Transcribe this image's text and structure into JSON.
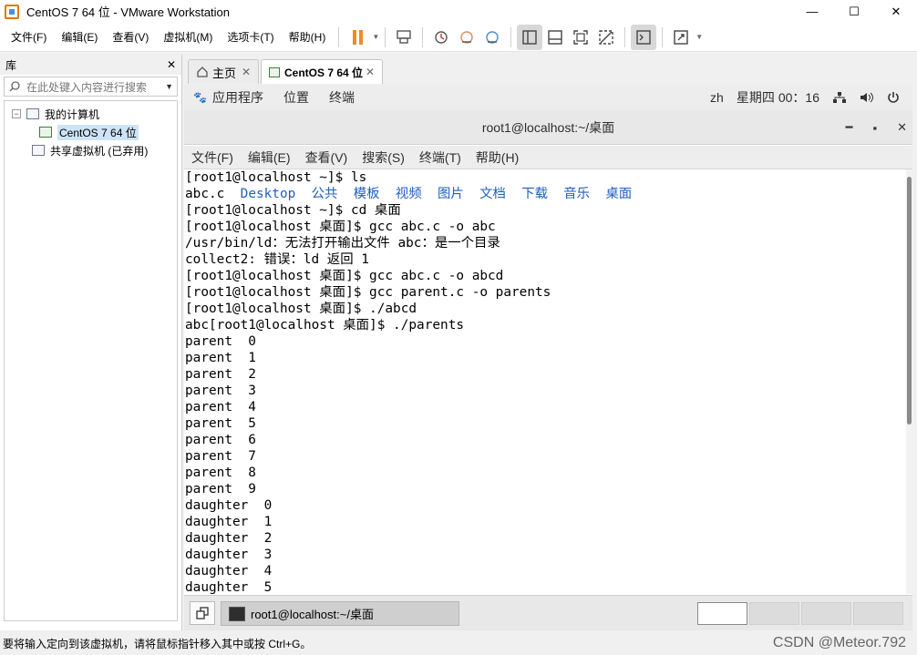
{
  "window": {
    "title": "CentOS 7 64 位 - VMware Workstation"
  },
  "menu": [
    "文件(F)",
    "编辑(E)",
    "查看(V)",
    "虚拟机(M)",
    "选项卡(T)",
    "帮助(H)"
  ],
  "library": {
    "title": "库",
    "search_placeholder": "在此处键入内容进行搜索",
    "tree": {
      "my_computer": "我的计算机",
      "vm": "CentOS 7 64 位",
      "shared": "共享虚拟机 (已弃用)"
    }
  },
  "tabs": {
    "home": "主页",
    "vm": "CentOS 7 64 位"
  },
  "gnome": {
    "apps": "应用程序",
    "places": "位置",
    "terminal": "终端",
    "lang": "zh",
    "day": "星期四",
    "time": "00：16"
  },
  "terminal": {
    "title": "root1@localhost:~/桌面",
    "menu": [
      "文件(F)",
      "编辑(E)",
      "查看(V)",
      "搜索(S)",
      "终端(T)",
      "帮助(H)"
    ],
    "lines": [
      "[root1@localhost ~]$ ls",
      "abc.c",
      "[root1@localhost ~]$ cd 桌面",
      "[root1@localhost 桌面]$ gcc abc.c -o abc",
      "/usr/bin/ld：无法打开输出文件 abc：是一个目录",
      "collect2: 错误：ld 返回 1",
      "[root1@localhost 桌面]$ gcc abc.c -o abcd",
      "[root1@localhost 桌面]$ gcc parent.c -o parents",
      "[root1@localhost 桌面]$ ./abcd",
      "abc[root1@localhost 桌面]$ ./parents",
      "parent  0",
      "parent  1",
      "parent  2",
      "parent  3",
      "parent  4",
      "parent  5",
      "parent  6",
      "parent  7",
      "parent  8",
      "parent  9",
      "daughter  0",
      "daughter  1",
      "daughter  2",
      "daughter  3",
      "daughter  4",
      "daughter  5"
    ],
    "ls_dirs": "Desktop  公共  模板  视频  图片  文档  下载  音乐  桌面"
  },
  "taskbar": {
    "task": "root1@localhost:~/桌面"
  },
  "status": "要将输入定向到该虚拟机，请将鼠标指针移入其中或按 Ctrl+G。",
  "watermark": "CSDN @Meteor.792",
  "colors": {
    "accent_pause": "#f08a24",
    "dir_blue": "#1f5fbf"
  }
}
